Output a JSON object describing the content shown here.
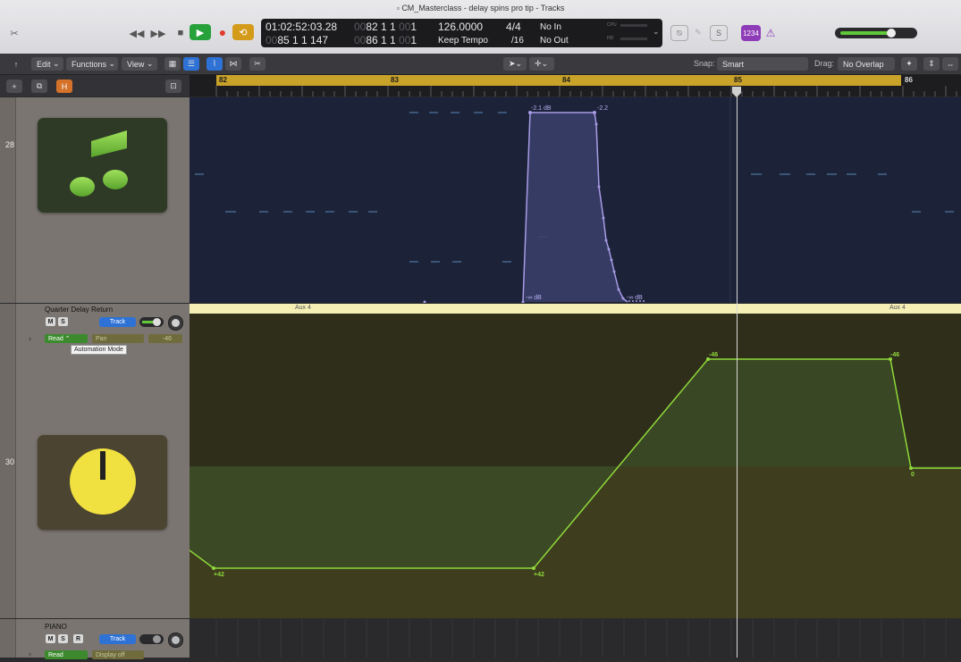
{
  "window": {
    "title": "CM_Masterclass - delay spins pro tip - Tracks"
  },
  "transport": {
    "position_time": "01:02:52:03.28",
    "position_bars_top": "82  1  1",
    "position_bars_top_tick": "1",
    "position_bars_bottom": "85  1  1  147",
    "end_bars_top": "00",
    "end_bars": "86  1  1",
    "end_bars_tick": "1",
    "tempo": "126.0000",
    "tempo_mode": "Keep Tempo",
    "time_signature": "4/4",
    "division": "/16",
    "midi_in": "No In",
    "midi_out": "No Out",
    "cpu_label": "CPU",
    "hd_label": "HD",
    "count_in": "1234"
  },
  "toolbar": {
    "edit": "Edit",
    "functions": "Functions",
    "view": "View",
    "snap_label": "Snap:",
    "snap_value": "Smart",
    "drag_label": "Drag:",
    "drag_value": "No Overlap",
    "h_button": "H"
  },
  "ruler": {
    "bars": [
      "82",
      "83",
      "84",
      "85",
      "86"
    ]
  },
  "tracks": [
    {
      "number": "28",
      "icon": "music-note-icon",
      "automation_labels": [
        "-2.1 dB",
        "-2.2",
        "-∞ dB",
        "-∞ dB"
      ]
    },
    {
      "number": "30",
      "name": "Quarter Delay Return",
      "mute": "M",
      "solo": "S",
      "track_label": "Track",
      "automation_mode": "Read",
      "automation_param": "Pan",
      "automation_value": "-46",
      "tooltip": "Automation Mode",
      "region_name_left": "Aux 4",
      "region_name_right": "Aux 4",
      "icon": "knob-icon",
      "automation_labels": [
        "+42",
        "+42",
        "-46",
        "-46",
        "0"
      ]
    },
    {
      "name": "PIANO",
      "mute": "M",
      "solo": "S",
      "record": "R",
      "track_label": "Track",
      "automation_mode": "Read",
      "automation_param": "Display off"
    }
  ],
  "colors": {
    "accent_blue": "#2f72d6",
    "cycle_yellow": "#c9a22a",
    "automation_green": "#8fd83a",
    "volume_purple": "#a89be6"
  }
}
